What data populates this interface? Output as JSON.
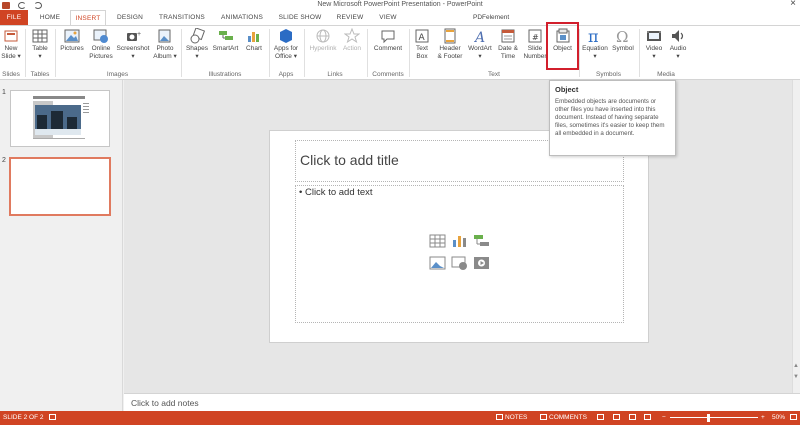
{
  "window": {
    "title": "New Microsoft PowerPoint Presentation - PowerPoint",
    "close_glyph": "×"
  },
  "tabs": [
    {
      "label": "FILE"
    },
    {
      "label": "HOME"
    },
    {
      "label": "INSERT"
    },
    {
      "label": "DESIGN"
    },
    {
      "label": "TRANSITIONS"
    },
    {
      "label": "ANIMATIONS"
    },
    {
      "label": "SLIDE SHOW"
    },
    {
      "label": "REVIEW"
    },
    {
      "label": "VIEW"
    }
  ],
  "pdfelement_tab": "PDFelement",
  "ribbon": {
    "groups": {
      "slides": "Slides",
      "tables": "Tables",
      "images": "Images",
      "illustrations": "Illustrations",
      "apps": "Apps",
      "links": "Links",
      "comments": "Comments",
      "text": "Text",
      "symbols": "Symbols",
      "media": "Media"
    },
    "buttons": {
      "new_slide": [
        "New",
        "Slide ▾"
      ],
      "table": [
        "Table",
        "▾"
      ],
      "pictures": [
        "Pictures",
        ""
      ],
      "online_pictures": [
        "Online",
        "Pictures"
      ],
      "screenshot": [
        "Screenshot",
        "▾"
      ],
      "photo_album": [
        "Photo",
        "Album ▾"
      ],
      "shapes": [
        "Shapes",
        "▾"
      ],
      "smartart": [
        "SmartArt",
        ""
      ],
      "chart": [
        "Chart",
        ""
      ],
      "apps_for_office": [
        "Apps for",
        "Office ▾"
      ],
      "hyperlink": [
        "Hyperlink",
        ""
      ],
      "action": [
        "Action",
        ""
      ],
      "comment": [
        "Comment",
        ""
      ],
      "text_box": [
        "Text",
        "Box"
      ],
      "header_footer": [
        "Header",
        "& Footer"
      ],
      "wordart": [
        "WordArt",
        "▾"
      ],
      "date_time": [
        "Date &",
        "Time"
      ],
      "slide_number": [
        "Slide",
        "Number"
      ],
      "object": [
        "Object",
        ""
      ],
      "equation": [
        "Equation",
        "▾"
      ],
      "symbol": [
        "Symbol",
        ""
      ],
      "video": [
        "Video",
        "▾"
      ],
      "audio": [
        "Audio",
        "▾"
      ]
    }
  },
  "tooltip": {
    "title": "Object",
    "body": "Embedded objects are documents or other files you have inserted into this document. Instead of having separate files, sometimes it's easier to keep them all embedded in a document."
  },
  "thumbnails": [
    {
      "number": "1"
    },
    {
      "number": "2"
    }
  ],
  "slide": {
    "title_placeholder": "Click to add title",
    "body_placeholder": "Click to add text"
  },
  "notes_placeholder": "Click to add notes",
  "statusbar": {
    "slide_info": "SLIDE 2 OF 2",
    "notes": "NOTES",
    "comments": "COMMENTS",
    "zoom": "50%"
  },
  "colors": {
    "accent": "#d04423",
    "highlight_box": "#d21f2c"
  }
}
